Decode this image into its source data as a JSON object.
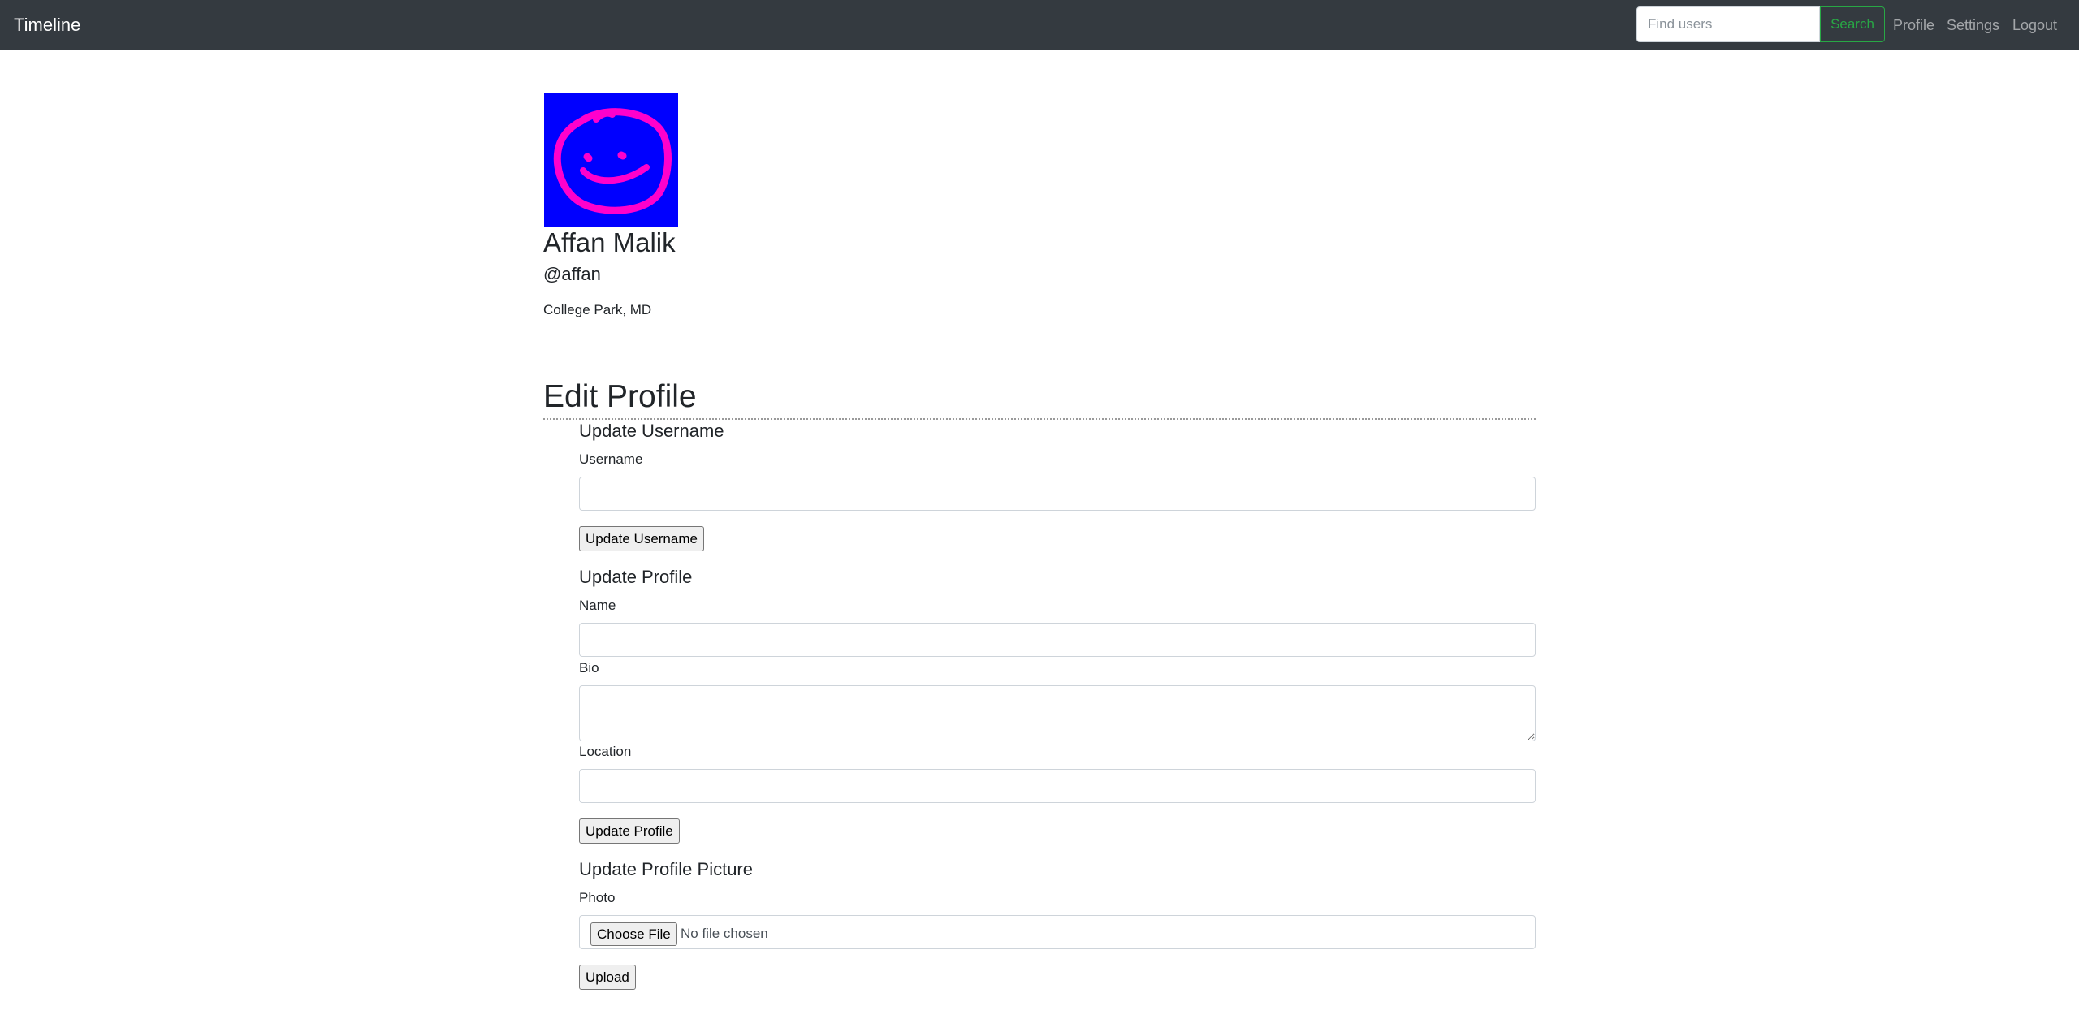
{
  "navbar": {
    "brand": "Timeline",
    "search_placeholder": "Find users",
    "search_button": "Search",
    "links": {
      "profile": "Profile",
      "settings": "Settings",
      "logout": "Logout"
    }
  },
  "profile": {
    "avatar_icon": "smiley-face-drawing",
    "avatar_colors": {
      "background": "#0000ff",
      "stroke": "#ff00cc"
    },
    "name": "Affan Malik",
    "handle": "@affan",
    "location": "College Park, MD"
  },
  "edit": {
    "title": "Edit Profile",
    "username_section": {
      "title": "Update Username",
      "username_label": "Username",
      "username_value": "",
      "submit": "Update Username"
    },
    "profile_section": {
      "title": "Update Profile",
      "name_label": "Name",
      "name_value": "",
      "bio_label": "Bio",
      "bio_value": "",
      "location_label": "Location",
      "location_value": "",
      "submit": "Update Profile"
    },
    "picture_section": {
      "title": "Update Profile Picture",
      "photo_label": "Photo",
      "choose_file": "Choose File",
      "file_status": "No file chosen",
      "submit": "Upload"
    }
  },
  "colors": {
    "navbar_bg": "#343a40",
    "search_accent": "#28a745"
  }
}
